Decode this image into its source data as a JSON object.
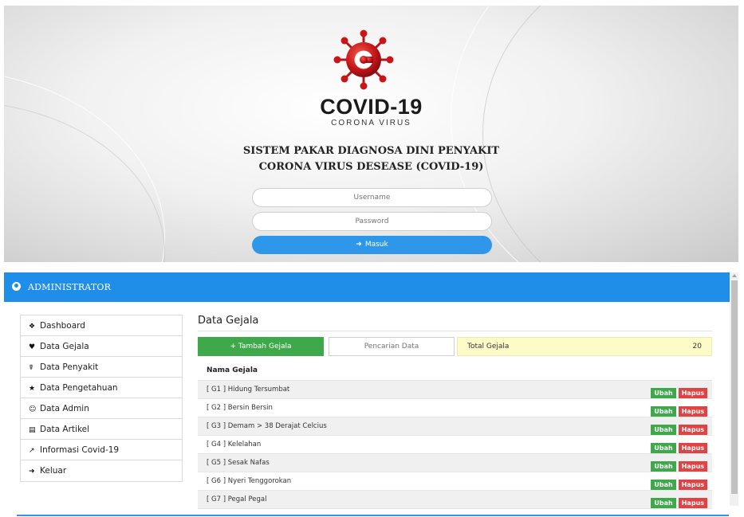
{
  "login": {
    "brand_title": "COVID-19",
    "brand_subtitle": "CORONA VIRUS",
    "app_title_line1": "SISTEM PAKAR DIAGNOSA DINI PENYAKIT",
    "app_title_line2": "CORONA VIRUS DESEASE (COVID-19)",
    "username_placeholder": "Username",
    "password_placeholder": "Password",
    "submit_label": "Masuk",
    "colors": {
      "accent": "#2e97ea",
      "logo_red": "#d11f1f"
    }
  },
  "admin": {
    "header_title": "ADMINISTRATOR",
    "sidebar": [
      {
        "icon": "dashboard-icon",
        "glyph": "❖",
        "label": "Dashboard"
      },
      {
        "icon": "heartbeat-icon",
        "glyph": "♥",
        "label": "Data Gejala"
      },
      {
        "icon": "wheelchair-icon",
        "glyph": "☤",
        "label": "Data Penyakit"
      },
      {
        "icon": "star-icon",
        "glyph": "★",
        "label": "Data Pengetahuan"
      },
      {
        "icon": "user-circle-icon",
        "glyph": "☺",
        "label": "Data Admin"
      },
      {
        "icon": "newspaper-icon",
        "glyph": "▤",
        "label": "Data Artikel"
      },
      {
        "icon": "line-chart-icon",
        "glyph": "↗",
        "label": "Informasi Covid-19"
      },
      {
        "icon": "sign-out-icon",
        "glyph": "➜",
        "label": "Keluar"
      }
    ],
    "page_title": "Data Gejala",
    "add_button_label": "+ Tambah Gejala",
    "search_placeholder": "Pencarian Data",
    "total_label": "Total Gejala",
    "total_value": "20",
    "table_header": "Nama Gejala",
    "edit_label": "Ubah",
    "delete_label": "Hapus",
    "rows": [
      "[ G1 ] Hidung Tersumbat",
      "[ G2 ] Bersin Bersin",
      "[ G3 ] Demam > 38 Derajat Celcius",
      "[ G4 ] Kelelahan",
      "[ G5 ] Sesak Nafas",
      "[ G6 ] Nyeri Tenggorokan",
      "[ G7 ] Pegal Pegal"
    ],
    "colors": {
      "header": "#1f8ee8",
      "success": "#3fa84a",
      "danger": "#e04343",
      "total_bg": "#fdfcc9"
    }
  }
}
